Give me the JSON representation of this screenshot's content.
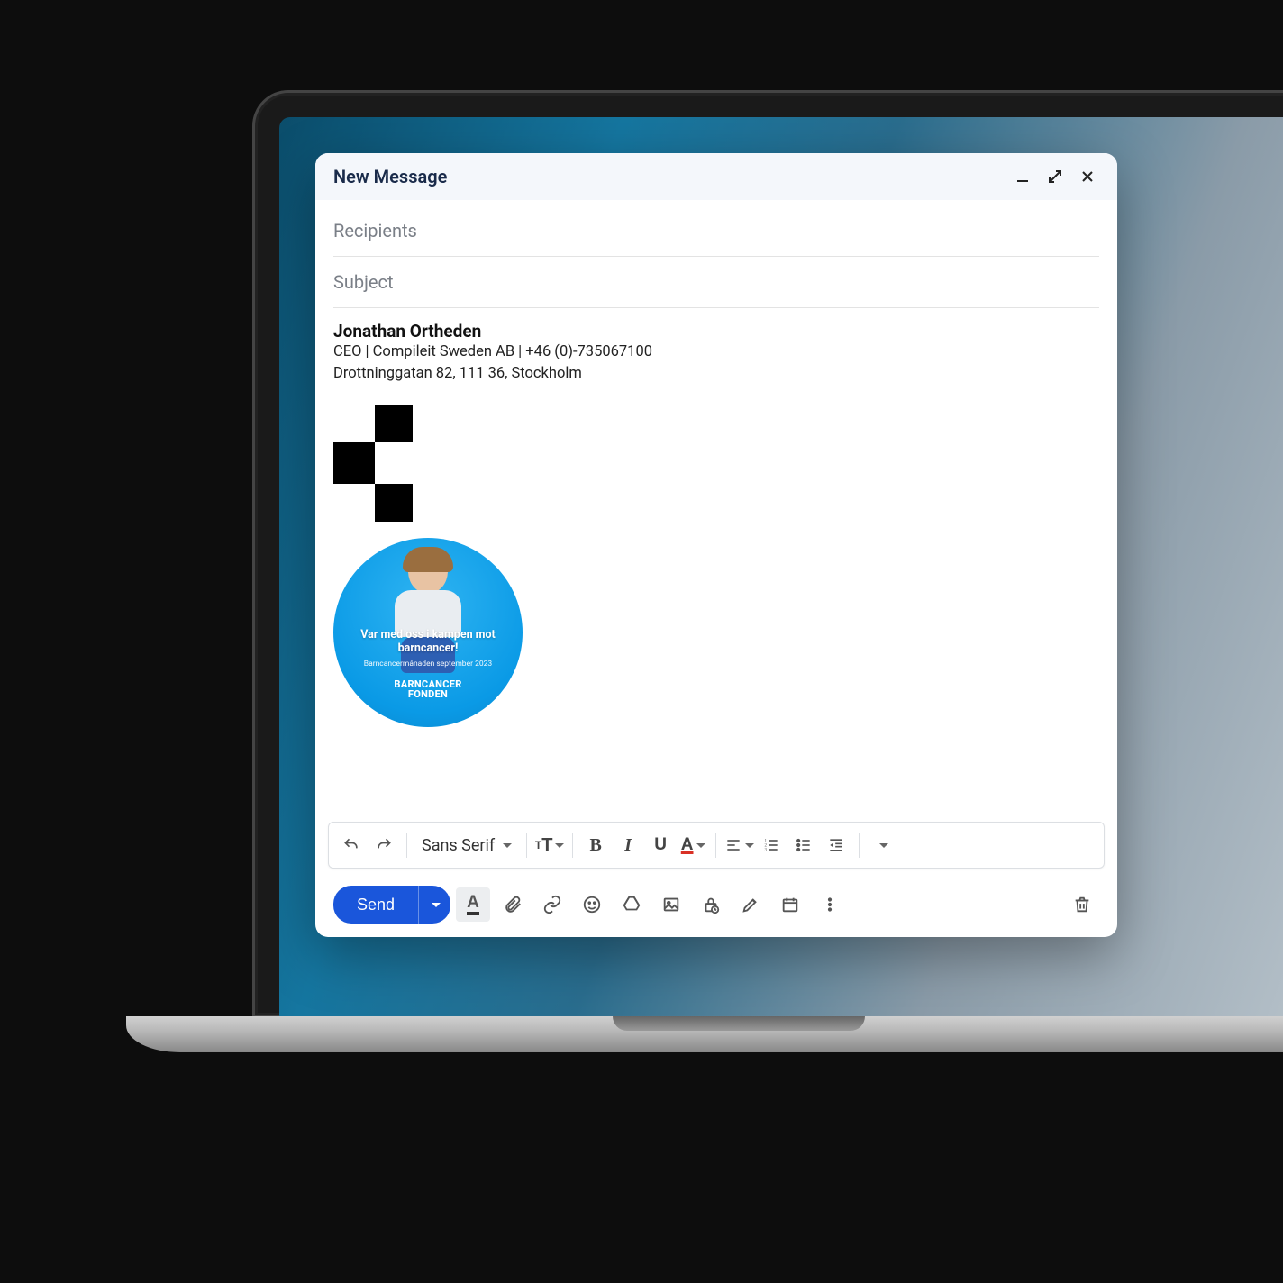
{
  "window": {
    "title": "New Message"
  },
  "fields": {
    "recipients_placeholder": "Recipients",
    "subject_placeholder": "Subject"
  },
  "signature": {
    "name": "Jonathan Ortheden",
    "line1": "CEO | Compileit Sweden AB | +46 (0)-735067100",
    "line2": "Drottninggatan 82, 111 36, Stockholm"
  },
  "badge": {
    "headline": "Var med oss i kampen mot barncancer!",
    "subline": "Barncancermånaden september 2023",
    "brand_line1": "BARNCANCER",
    "brand_line2": "FONDEN"
  },
  "format_toolbar": {
    "font_label": "Sans Serif"
  },
  "actions": {
    "send_label": "Send"
  }
}
